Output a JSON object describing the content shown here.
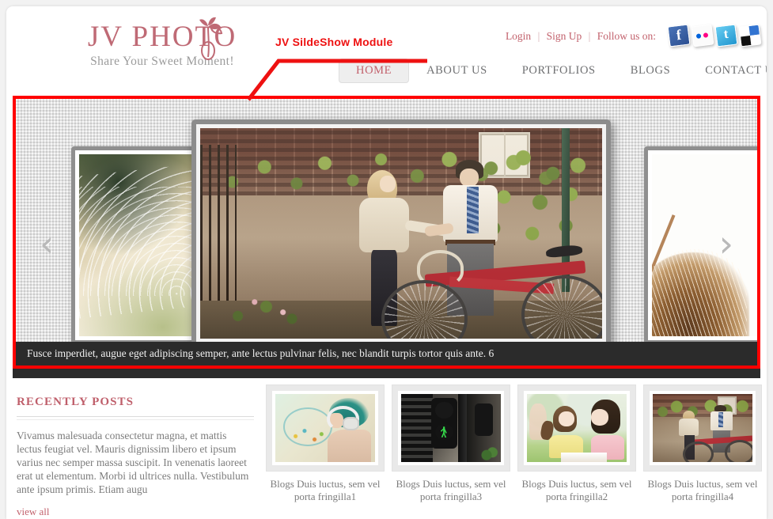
{
  "annotation": {
    "label": "JV SildeShow Module",
    "color": "#ee1111"
  },
  "header": {
    "logo_text": "JV PHOTO",
    "tagline": "Share Your Sweet Moment!",
    "brand_color": "#bf6a75",
    "toplinks": {
      "login": "Login",
      "signup": "Sign Up",
      "follow": "Follow us on:",
      "separator": "|"
    },
    "socials": [
      {
        "name": "facebook-icon",
        "color": "#3b5998"
      },
      {
        "name": "flickr-icon",
        "color": "#ff0084"
      },
      {
        "name": "twitter-icon",
        "color": "#2196cf"
      },
      {
        "name": "delicious-icon",
        "color": "#3274d1"
      }
    ],
    "nav": [
      {
        "label": "HOME",
        "active": true
      },
      {
        "label": "ABOUT US",
        "active": false
      },
      {
        "label": "PORTFOLIOS",
        "active": false
      },
      {
        "label": "BLOGS",
        "active": false
      },
      {
        "label": "CONTACT US",
        "active": false
      }
    ]
  },
  "slideshow": {
    "prev_arrow": "‹",
    "next_arrow": "›",
    "caption": "Fusce imperdiet, augue eget adipiscing semper, ante lectus pulvinar felis, nec blandit turpis tortor quis ante. 6",
    "slides": [
      {
        "name": "slide-sprinkler",
        "alt": "water sprinkler spraying in warm sepia garden"
      },
      {
        "name": "slide-couple-bicycle",
        "alt": "couple holding hands beside red bicycle at ivy wall"
      },
      {
        "name": "slide-blonde-bright",
        "alt": "bright white photo with blonde hair"
      }
    ],
    "border_color": "#ff0000"
  },
  "content": {
    "recent": {
      "heading": "RECENTLY POSTS",
      "body": "Vivamus malesuada consectetur magna, et mattis lectus feugiat vel. Mauris dignissim libero et ipsum varius nec semper massa suscipit. In venenatis laoreet erat ut elementum. Morbi id ultrices nulla. Vestibulum ante ipsum primis. Etiam augu",
      "view_all": "view all"
    },
    "thumbs": [
      {
        "caption": "Blogs Duis luctus, sem vel porta fringilla1",
        "art": "t1",
        "alt": "woman with green hair and headphones"
      },
      {
        "caption": "Blogs Duis luctus, sem vel porta fringilla3",
        "art": "t2",
        "alt": "traffic light with green walk signal"
      },
      {
        "caption": "Blogs Duis luctus, sem vel porta fringilla2",
        "art": "t3",
        "alt": "mother and daughter reading on grass"
      },
      {
        "caption": "Blogs Duis luctus, sem vel porta fringilla4",
        "art": "t4",
        "alt": "couple with red bicycle"
      }
    ]
  }
}
